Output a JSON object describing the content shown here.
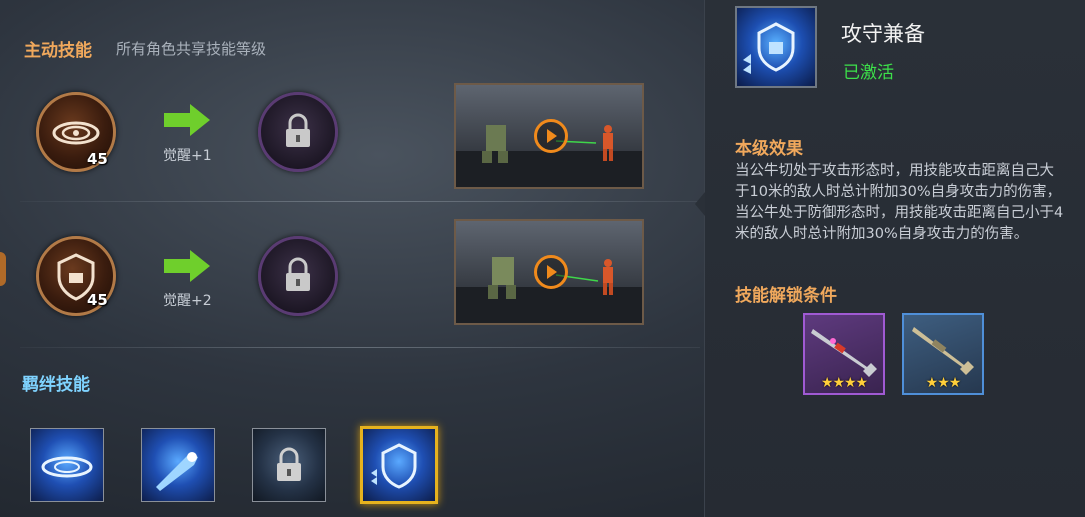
{
  "active_skills": {
    "title": "主动技能",
    "subtitle": "所有角色共享技能等级",
    "rows": [
      {
        "level": "45",
        "awaken_label": "觉醒+1"
      },
      {
        "level": "45",
        "awaken_label": "觉醒+2"
      }
    ]
  },
  "bond_skills": {
    "title": "羁绊技能"
  },
  "detail": {
    "skill_name": "攻守兼备",
    "status": "已激活",
    "effect_title": "本级效果",
    "effect_text": "当公牛切处于攻击形态时，用技能攻击距离自己大于10米的敌人时总计附加30%自身攻击力的伤害，当公牛处于防御形态时，用技能攻击距离自己小于4米的敌人时总计附加30%自身攻击力的伤害。",
    "unlock_title": "技能解锁条件",
    "weapons": [
      {
        "rarity": "purple",
        "stars": "★★★★"
      },
      {
        "rarity": "blue",
        "stars": "★★★"
      }
    ]
  },
  "colors": {
    "accent_orange": "#f0a85c",
    "active_green": "#3de14a",
    "selected_gold": "#e6b21e"
  }
}
